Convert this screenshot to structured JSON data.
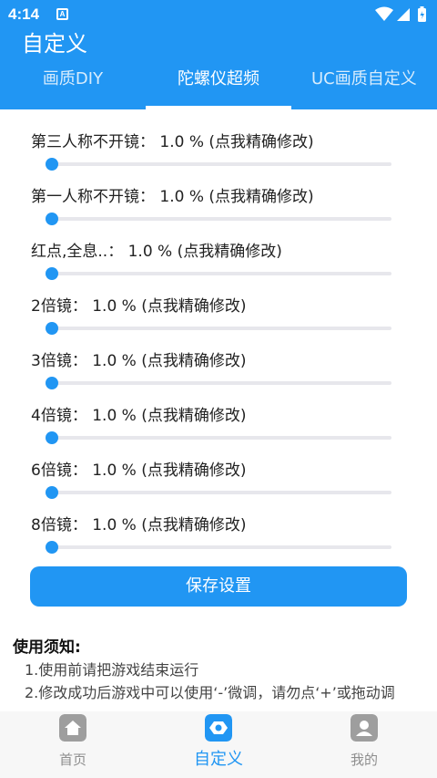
{
  "status_bar": {
    "time": "4:14",
    "notification_icon": "A"
  },
  "app": {
    "title": "自定义"
  },
  "tabs": [
    {
      "label": "画质DIY",
      "active": false
    },
    {
      "label": "陀螺仪超频",
      "active": true
    },
    {
      "label": "UC画质自定义",
      "active": false
    }
  ],
  "settings": [
    {
      "label": "第三人称不开镜： 1.0 % (点我精确修改)",
      "value_percent": 1.0
    },
    {
      "label": "第一人称不开镜： 1.0 % (点我精确修改)",
      "value_percent": 1.0
    },
    {
      "label": "红点,全息..： 1.0 % (点我精确修改)",
      "value_percent": 1.0
    },
    {
      "label": "2倍镜： 1.0 % (点我精确修改)",
      "value_percent": 1.0
    },
    {
      "label": "3倍镜： 1.0 % (点我精确修改)",
      "value_percent": 1.0
    },
    {
      "label": "4倍镜： 1.0 % (点我精确修改)",
      "value_percent": 1.0
    },
    {
      "label": "6倍镜： 1.0 % (点我精确修改)",
      "value_percent": 1.0
    },
    {
      "label": "8倍镜： 1.0 % (点我精确修改)",
      "value_percent": 1.0
    }
  ],
  "save_button": "保存设置",
  "notice": {
    "title": "使用须知:",
    "lines": [
      "1.使用前请把游戏结束运行",
      "2.修改成功后游戏中可以使用‘-’微调，请勿点‘+’或拖动调"
    ]
  },
  "bottom_nav": [
    {
      "label": "首页",
      "icon": "home-icon",
      "active": false
    },
    {
      "label": "自定义",
      "icon": "customize-icon",
      "active": true
    },
    {
      "label": "我的",
      "icon": "profile-icon",
      "active": false
    }
  ],
  "colors": {
    "accent": "#2196f3",
    "background": "#f7f7f7"
  }
}
